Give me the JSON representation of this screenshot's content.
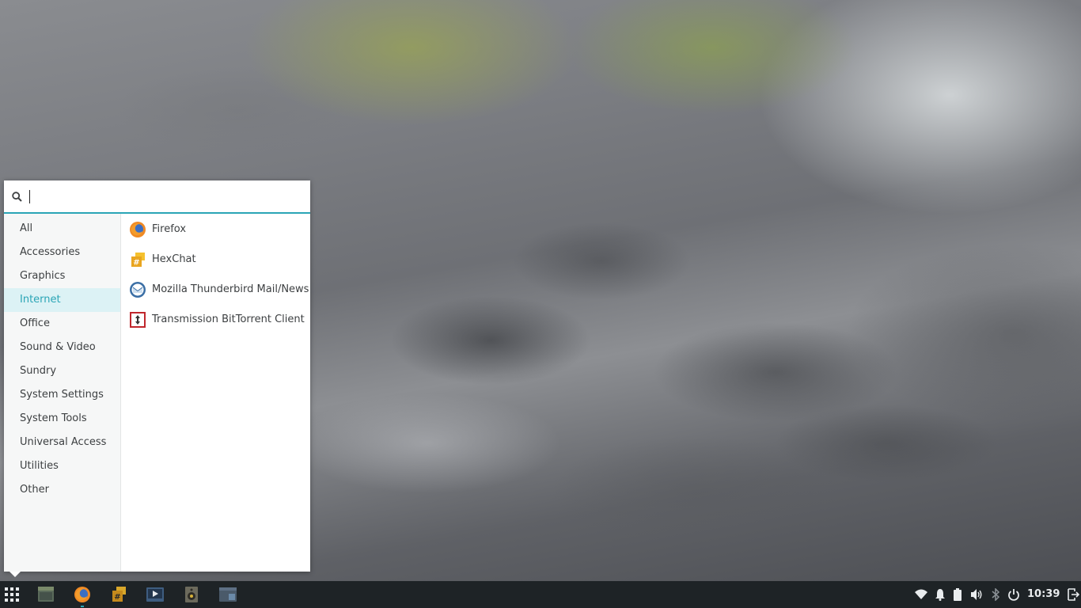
{
  "menu": {
    "search": {
      "value": "",
      "placeholder": ""
    },
    "categories": [
      {
        "label": "All"
      },
      {
        "label": "Accessories"
      },
      {
        "label": "Graphics"
      },
      {
        "label": "Internet",
        "active": true
      },
      {
        "label": "Office"
      },
      {
        "label": "Sound & Video"
      },
      {
        "label": "Sundry"
      },
      {
        "label": "System Settings"
      },
      {
        "label": "System Tools"
      },
      {
        "label": "Universal Access"
      },
      {
        "label": "Utilities"
      },
      {
        "label": "Other"
      }
    ],
    "apps": [
      {
        "label": "Firefox",
        "icon": "firefox-icon"
      },
      {
        "label": "HexChat",
        "icon": "hexchat-icon"
      },
      {
        "label": "Mozilla Thunderbird Mail/News",
        "icon": "thunderbird-icon"
      },
      {
        "label": "Transmission BitTorrent Client",
        "icon": "transmission-icon"
      }
    ]
  },
  "taskbar": {
    "apps": [
      {
        "icon": "file-manager-icon"
      },
      {
        "icon": "firefox-icon",
        "running": true
      },
      {
        "icon": "hexchat-icon"
      },
      {
        "icon": "video-player-icon"
      },
      {
        "icon": "audio-player-icon"
      },
      {
        "icon": "terminal-window-icon"
      }
    ],
    "tray": {
      "icons": [
        "wifi-icon",
        "notification-bell-icon",
        "battery-icon",
        "volume-icon",
        "bluetooth-icon",
        "power-icon",
        "logout-icon"
      ],
      "clock": "10:39"
    }
  },
  "colors": {
    "accent": "#2aa5b6",
    "taskbar": "#1e2326",
    "menu_bg": "#ffffff",
    "sidebar_bg": "#f6f7f7",
    "active_category_bg": "#dcf2f5"
  }
}
